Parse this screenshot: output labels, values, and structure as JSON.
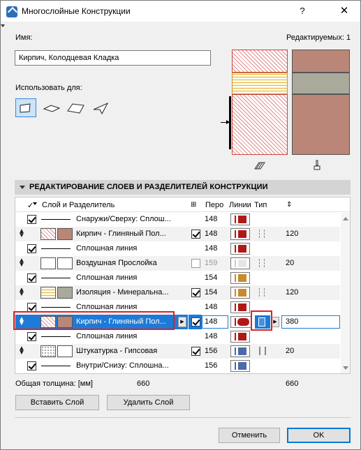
{
  "window": {
    "title": "Многослойные Конструкции",
    "help": "?",
    "close": "✕"
  },
  "name_label": "Имя:",
  "editable_label": "Редактируемых: 1",
  "name_value": "Кирпич, Колодцевая Кладка",
  "use_for_label": "Использовать для:",
  "use_for_icons": [
    "wall-icon",
    "slab-icon",
    "roof-icon",
    "shell-icon"
  ],
  "section_title": "РЕДАКТИРОВАНИЕ СЛОЕВ И РАЗДЕЛИТЕЛЕЙ КОНСТРУКЦИИ",
  "columns": {
    "layer": "Слой и Разделитель",
    "pen": "Перо",
    "lines": "Линии",
    "type": "Тип"
  },
  "rows": [
    {
      "kind": "line",
      "label": "Снаружи/Сверху: Сплош...",
      "pen": "148",
      "line_color": "#b01818"
    },
    {
      "kind": "layer",
      "label": "Кирпич - Глиняный Пол...",
      "pen": "148",
      "line_color": "#b01818",
      "type": "dash",
      "thick": "120",
      "swatch": "brick"
    },
    {
      "kind": "line",
      "label": "Сплошная линия",
      "pen": "148",
      "line_color": "#b01818"
    },
    {
      "kind": "layer",
      "label": "Воздушная Прослойка",
      "pen": "159",
      "line_color": "#dddddd",
      "type": "dash",
      "thick": "20",
      "swatch": "air"
    },
    {
      "kind": "line",
      "label": "Сплошная линия",
      "pen": "154",
      "line_color": "#c88a2a"
    },
    {
      "kind": "layer",
      "label": "Изоляция - Минеральна...",
      "pen": "154",
      "line_color": "#c88a2a",
      "type": "dash",
      "thick": "120",
      "swatch": "insulation"
    },
    {
      "kind": "line",
      "label": "Сплошная линия",
      "pen": "148",
      "line_color": "#b01818"
    },
    {
      "kind": "layer",
      "label": "Кирпич - Глиняный Пол...",
      "pen": "148",
      "line_color": "#b01818",
      "type": "selected",
      "thick": "380",
      "swatch": "brick",
      "selected": true
    },
    {
      "kind": "line",
      "label": "Сплошная линия",
      "pen": "148",
      "line_color": "#b01818"
    },
    {
      "kind": "layer",
      "label": "Штукатурка - Гипсовая",
      "pen": "156",
      "line_color": "#4a6aa8",
      "type": "solid",
      "thick": "20",
      "swatch": "plaster"
    },
    {
      "kind": "line",
      "label": "Внутри/Снизу: Сплошна...",
      "pen": "156",
      "line_color": "#4a6aa8"
    }
  ],
  "total_label": "Общая толщина: [мм]",
  "total_value_1": "660",
  "total_value_2": "660",
  "buttons": {
    "insert": "Вставить Слой",
    "delete": "Удалить Слой",
    "cancel": "Отменить",
    "ok": "OK"
  }
}
